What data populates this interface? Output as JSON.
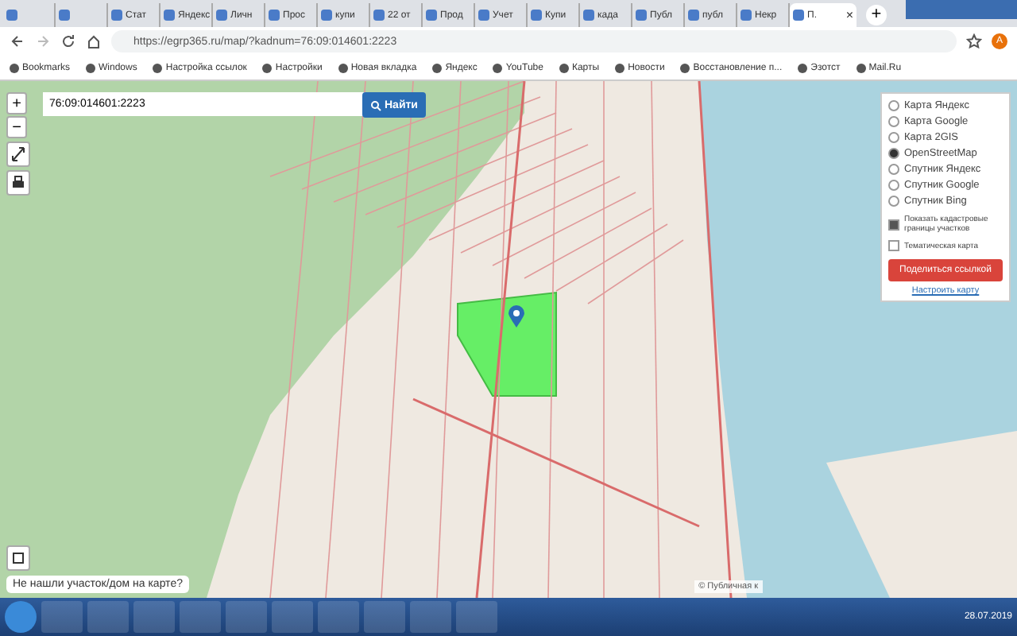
{
  "browser": {
    "tabs": [
      {
        "selected": false
      },
      {
        "selected": false
      },
      {
        "label": "Стат",
        "selected": false
      },
      {
        "label": "Яндекс",
        "selected": false
      },
      {
        "label": "Личн",
        "selected": false
      },
      {
        "label": "Прос",
        "selected": false
      },
      {
        "label": "купи",
        "selected": false
      },
      {
        "label": "22 от",
        "selected": false
      },
      {
        "label": "Прод",
        "selected": false
      },
      {
        "label": "Учет",
        "selected": false
      },
      {
        "label": "Купи",
        "selected": false
      },
      {
        "label": "када",
        "selected": false
      },
      {
        "label": "Публ",
        "selected": false
      },
      {
        "label": "публ",
        "selected": false
      },
      {
        "label": "Некр",
        "selected": false
      },
      {
        "label": "П.",
        "selected": true
      }
    ],
    "close_tab": "×",
    "new_tab": "+",
    "address": "https://egrp365.ru/map/?kadnum=76:09:014601:2223",
    "profile": "A",
    "bookmarks": [
      "Bookmarks",
      "Windows",
      "Настройка ссылок",
      "Настройки",
      "Новая вкладка",
      "Яндекс",
      "YouTube",
      "Карты",
      "Новости",
      "Восстановление п...",
      "Эзотст",
      "Mail.Ru"
    ]
  },
  "map": {
    "zoom_in": "+",
    "zoom_out": "−",
    "search": {
      "value": "76:09:014601:2223",
      "button": "Найти"
    },
    "layers": [
      {
        "label": "Карта Яндекс",
        "selected": false
      },
      {
        "label": "Карта Google",
        "selected": false
      },
      {
        "label": "Карта 2GIS",
        "selected": false
      },
      {
        "label": "OpenStreetMap",
        "selected": true
      },
      {
        "label": "Спутник Яндекс",
        "selected": false
      },
      {
        "label": "Спутник Google",
        "selected": false
      },
      {
        "label": "Спутник Bing",
        "selected": false
      }
    ],
    "options": [
      {
        "label": "Показать кадастровые границы участков",
        "checked": true
      },
      {
        "label": "Тематическая карта",
        "checked": false
      }
    ],
    "share_button": "Поделиться ссылкой",
    "settings_link": "Настроить карту",
    "help_tooltip": "Не нашли участок/дом на карте?",
    "attribution": "© Публичная к"
  },
  "taskbar": {
    "date": "28.07.2019"
  }
}
